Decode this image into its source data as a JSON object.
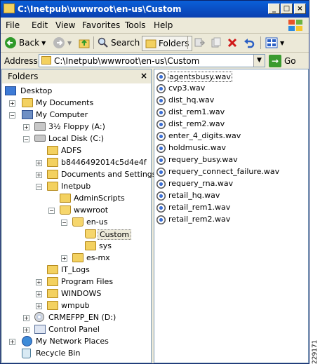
{
  "window": {
    "title": "C:\\Inetpub\\wwwroot\\en-us\\Custom"
  },
  "title_buttons": {
    "minimize": "_",
    "maximize": "□",
    "close": "×"
  },
  "menubar": {
    "items": [
      "File",
      "Edit",
      "View",
      "Favorites",
      "Tools",
      "Help"
    ]
  },
  "toolbar": {
    "back": "Back",
    "search": "Search",
    "folders": "Folders"
  },
  "address": {
    "label": "Address",
    "value": "C:\\Inetpub\\wwwroot\\en-us\\Custom",
    "go": "Go"
  },
  "folders_pane": {
    "title": "Folders",
    "close": "×",
    "tree": [
      {
        "label": "Desktop"
      },
      {
        "label": "My Documents",
        "expander": "+"
      },
      {
        "label": "My Computer",
        "expander": "−"
      },
      {
        "label": "3½ Floppy (A:)",
        "expander": "+"
      },
      {
        "label": "Local Disk (C:)",
        "expander": "−"
      },
      {
        "label": "ADFS"
      },
      {
        "label": "b8446492014c5d4e4f",
        "expander": "+"
      },
      {
        "label": "Documents and Settings",
        "expander": "+"
      },
      {
        "label": "Inetpub",
        "expander": "−"
      },
      {
        "label": "AdminScripts"
      },
      {
        "label": "wwwroot",
        "expander": "−"
      },
      {
        "label": "en-us",
        "expander": "−"
      },
      {
        "label": "Custom",
        "selected": true
      },
      {
        "label": "sys"
      },
      {
        "label": "es-mx",
        "expander": "+"
      },
      {
        "label": "IT_Logs"
      },
      {
        "label": "Program Files",
        "expander": "+"
      },
      {
        "label": "WINDOWS",
        "expander": "+"
      },
      {
        "label": "wmpub",
        "expander": "+"
      },
      {
        "label": "CRMEFPP_EN (D:)",
        "expander": "+"
      },
      {
        "label": "Control Panel",
        "expander": "+"
      },
      {
        "label": "My Network Places",
        "expander": "+"
      },
      {
        "label": "Recycle Bin"
      }
    ]
  },
  "files": [
    "agentsbusy.wav",
    "cvp3.wav",
    "dist_hq.wav",
    "dist_rem1.wav",
    "dist_rem2.wav",
    "enter_4_digits.wav",
    "holdmusic.wav",
    "requery_busy.wav",
    "requery_connect_failure.wav",
    "requery_rna.wav",
    "retail_hq.wav",
    "retail_rem1.wav",
    "retail_rem2.wav"
  ],
  "figure_id": "229171"
}
